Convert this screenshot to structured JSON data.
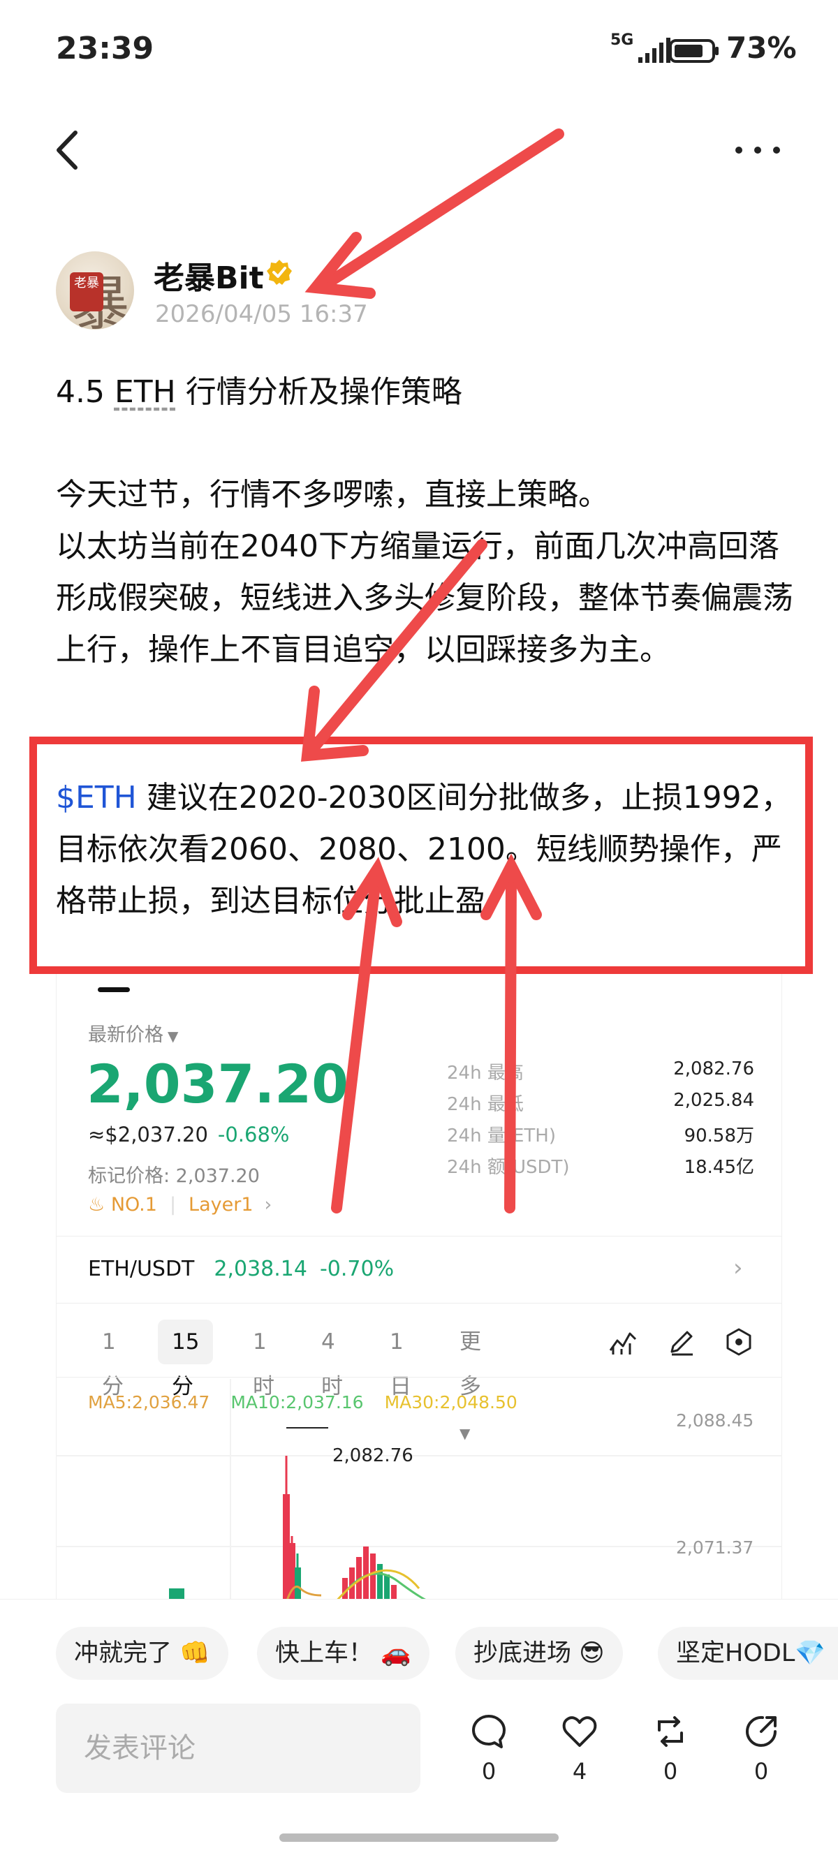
{
  "status_bar": {
    "time": "23:39",
    "network": "5G",
    "battery": "73%"
  },
  "author": {
    "name": "老暴Bit",
    "avatar_text": "老暴",
    "avatar_glyph": "暴",
    "timestamp": "2026/04/05 16:37",
    "verified": true
  },
  "post": {
    "title_prefix": "4.5 ",
    "title_ticker": "ETH",
    "title_suffix": " 行情分析及操作策略",
    "body_line1": "今天过节，行情不多啰嗦，直接上策略。",
    "body_line2": "以太坊当前在2040下方缩量运行，前面几次冲高回落形成假突破，短线进入多头修复阶段，整体节奏偏震荡上行，操作上不盲目追空，以回踩接多为主。",
    "highlight_ticker": "$ETH",
    "highlight_text": "建议在2020-2030区间分批做多，止损1992，目标依次看2060、2080、2100。短线顺势操作，严格带止损，到达目标位分批止盈"
  },
  "market": {
    "price_label": "最新价格",
    "last_price": "2,037.20",
    "usd_price": "≈$2,037.20",
    "change_pct": "-0.68%",
    "mark_price": "标记价格: 2,037.20",
    "rank": "NO.1",
    "category": "Layer1",
    "stats": [
      {
        "label": "24h  最高",
        "value": "2,082.76"
      },
      {
        "label": "24h  最低",
        "value": "2,025.84"
      },
      {
        "label": "24h  量(ETH)",
        "value": "90.58万"
      },
      {
        "label": "24h  额(USDT)",
        "value": "18.45亿"
      }
    ],
    "pair": "ETH/USDT",
    "pair_price": "2,038.14",
    "pair_change": "-0.70%",
    "intervals": [
      "1分",
      "15分",
      "1时",
      "4时",
      "1日",
      "更多"
    ],
    "active_interval": "15分",
    "ma5": "MA5:2,036.47",
    "ma10": "MA10:2,037.16",
    "ma30": "MA30:2,048.50",
    "high_marker": "2,082.76",
    "axis_labels": [
      "2,088.45",
      "2,071.37"
    ],
    "colors": {
      "up": "#1aa672",
      "down": "#e8384f",
      "accent": "#e59a34"
    }
  },
  "quick_replies": [
    "冲就完了 👊",
    "快上车！ 🚗",
    "抄底进场 😎",
    "坚定HODL💎"
  ],
  "comment": {
    "placeholder": "发表评论"
  },
  "actions": {
    "comments": "0",
    "likes": "4",
    "reposts": "0",
    "shares": "0"
  }
}
